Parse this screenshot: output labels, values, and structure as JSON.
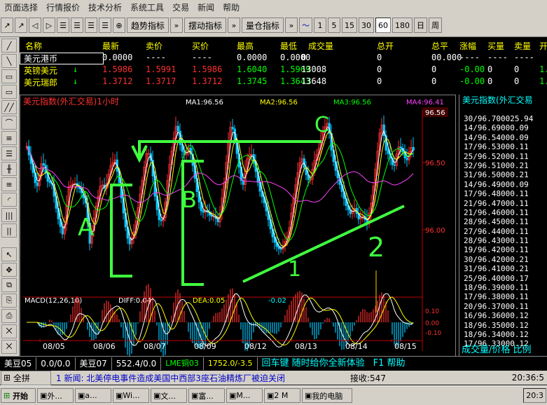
{
  "menu": [
    "页面选择",
    "行情报价",
    "技术分析",
    "系统工具",
    "交易",
    "新闻",
    "帮助"
  ],
  "toolbar": {
    "indicator_buttons": [
      "趋势指标",
      "摆动指标",
      "量仓指标"
    ],
    "periods": [
      "1",
      "5",
      "15",
      "30",
      "60",
      "180",
      "日",
      "周"
    ],
    "active_period": "60"
  },
  "quote": {
    "headers": [
      "名称",
      "最新",
      "卖价",
      "买价",
      "最高",
      "最低",
      "成交量",
      "总开",
      "总平",
      "涨幅",
      "买量",
      "卖量",
      "开"
    ],
    "rows": [
      {
        "name": "美元港币",
        "arrow": "",
        "last": "0.0000",
        "ask": "----",
        "bid": "----",
        "high": "0.0000",
        "low": "0.0000",
        "volume": "0",
        "open_total": "0",
        "close_total": "00.000",
        "change": "----",
        "bidvol": "----",
        "askvol": "----",
        "open": "",
        "color": "wht"
      },
      {
        "name": "英镑美元",
        "arrow": "↓",
        "last": "1.5986",
        "ask": "1.5991",
        "bid": "1.5986",
        "high": "1.6040",
        "low": "1.5969",
        "volume": "13008",
        "open_total": "0",
        "close_total": "0",
        "change": "-0.00",
        "bidvol": "0",
        "askvol": "0",
        "open": "1.60",
        "color": "red"
      },
      {
        "name": "美元瑞郎",
        "arrow": "↓",
        "last": "1.3712",
        "ask": "1.3717",
        "bid": "1.3712",
        "high": "1.3745",
        "low": "1.3643",
        "volume": "13648",
        "open_total": "0",
        "close_total": "0",
        "change": "-0.00",
        "bidvol": "0",
        "askvol": "0",
        "open": "1.37",
        "color": "red"
      }
    ]
  },
  "chart_header": {
    "title": "美元指数(外汇交易)1小时",
    "ma1": "MA1:96.56",
    "ma2": "MA2:96.56",
    "ma3": "MA3:96.56",
    "ma4": "MA4:96.41",
    "price_tag": "96.56"
  },
  "chart_data": {
    "type": "candlestick",
    "y_ticks": [
      "96.50",
      "96.00"
    ],
    "x_labels": [
      "08/05",
      "08/06",
      "08/07",
      "08/09",
      "08/12",
      "08/13",
      "08/14",
      "08/15"
    ],
    "macd_header": {
      "name": "MACD(12,26,10)",
      "diff": "DIFF:0.04",
      "dea": "DEA:0.05",
      "macd": "-0.02"
    },
    "macd_ticks": [
      "0.10",
      "0.00",
      "-0.10"
    ],
    "annotations": [
      "A",
      "B",
      "C",
      "1",
      "2"
    ]
  },
  "right_panel": {
    "title": "美元指数(外汇交易",
    "ticks": [
      "30/96.7000",
      "14/96.6900",
      "14/96.5400",
      "17/96.5300",
      "25/96.5200",
      "32/96.5100",
      "31/96.5000",
      "14/96.4900",
      "17/96.4800",
      "21/96.4700",
      "21/96.4600",
      "28/96.4500",
      "27/96.4400",
      "28/96.4300",
      "19/96.4200",
      "30/96.4200",
      "31/96.4100",
      "25/96.4000",
      "18/96.3900",
      "17/96.3800",
      "20/96.3700",
      "16/96.3600",
      "18/96.3500",
      "18/96.3400",
      "17/96.3300"
    ],
    "tick_suffix": [
      "25.94",
      "0.09",
      "0.09",
      "0.11",
      "0.11",
      "0.21",
      "0.21",
      "0.09",
      "0.11",
      "0.11",
      "0.11",
      "0.11",
      "0.11",
      "0.11",
      "0.11",
      "0.21",
      "0.21",
      "0.17",
      "0.11",
      "0.11",
      "0.11",
      "0.12",
      "0.12",
      "0.12",
      "0.12"
    ],
    "footer": "成交量/价格  比例"
  },
  "status": {
    "cells": [
      "美豆05",
      "0.0/0.0",
      "美豆07",
      "552.4/0.0",
      "LME铜03",
      "1752.0/-3.5"
    ],
    "message": "回车键 随时给你全新体验",
    "help": "F1 帮助"
  },
  "news": {
    "label": "全拼",
    "text": "1 新闻: 北美停电事件造成美国中西部3座石油精炼厂被迫关闭",
    "recv": "接收:547",
    "clock": "20:36:5"
  },
  "taskbar": {
    "start": "开始",
    "tasks": [
      "外...",
      "a...",
      "Wi...",
      "文...",
      "富...",
      "M...",
      "2 M",
      "我的电脑"
    ],
    "clock": "20:3"
  }
}
